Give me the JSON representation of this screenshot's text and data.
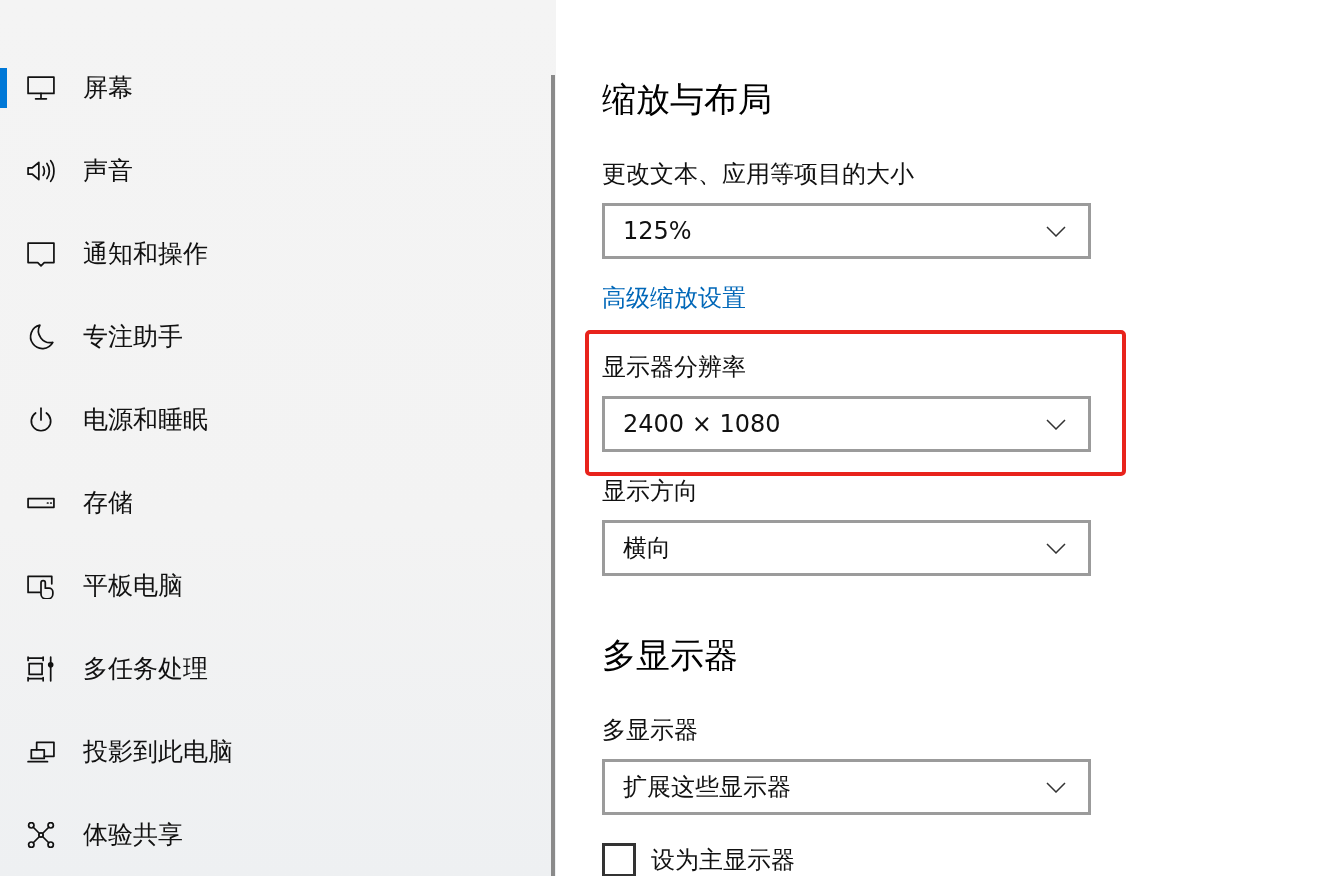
{
  "sidebar": {
    "items": [
      {
        "label": "屏幕",
        "selected": true
      },
      {
        "label": "声音",
        "selected": false
      },
      {
        "label": "通知和操作",
        "selected": false
      },
      {
        "label": "专注助手",
        "selected": false
      },
      {
        "label": "电源和睡眠",
        "selected": false
      },
      {
        "label": "存储",
        "selected": false
      },
      {
        "label": "平板电脑",
        "selected": false
      },
      {
        "label": "多任务处理",
        "selected": false
      },
      {
        "label": "投影到此电脑",
        "selected": false
      },
      {
        "label": "体验共享",
        "selected": false
      }
    ]
  },
  "sections": [
    {
      "heading": "缩放与布局",
      "items": [
        {
          "kind": "dropdown",
          "label": "更改文本、应用等项目的大小",
          "value": "125%",
          "highlighted": false
        },
        {
          "kind": "link",
          "label": "高级缩放设置"
        },
        {
          "kind": "dropdown",
          "label": "显示器分辨率",
          "value": "2400 × 1080",
          "highlighted": true
        },
        {
          "kind": "dropdown",
          "label": "显示方向",
          "value": "横向",
          "highlighted": false
        }
      ]
    },
    {
      "heading": "多显示器",
      "items": [
        {
          "kind": "dropdown",
          "label": "多显示器",
          "value": "扩展这些显示器",
          "highlighted": false
        },
        {
          "kind": "checkbox",
          "label": "设为主显示器",
          "checked": false
        }
      ]
    }
  ]
}
